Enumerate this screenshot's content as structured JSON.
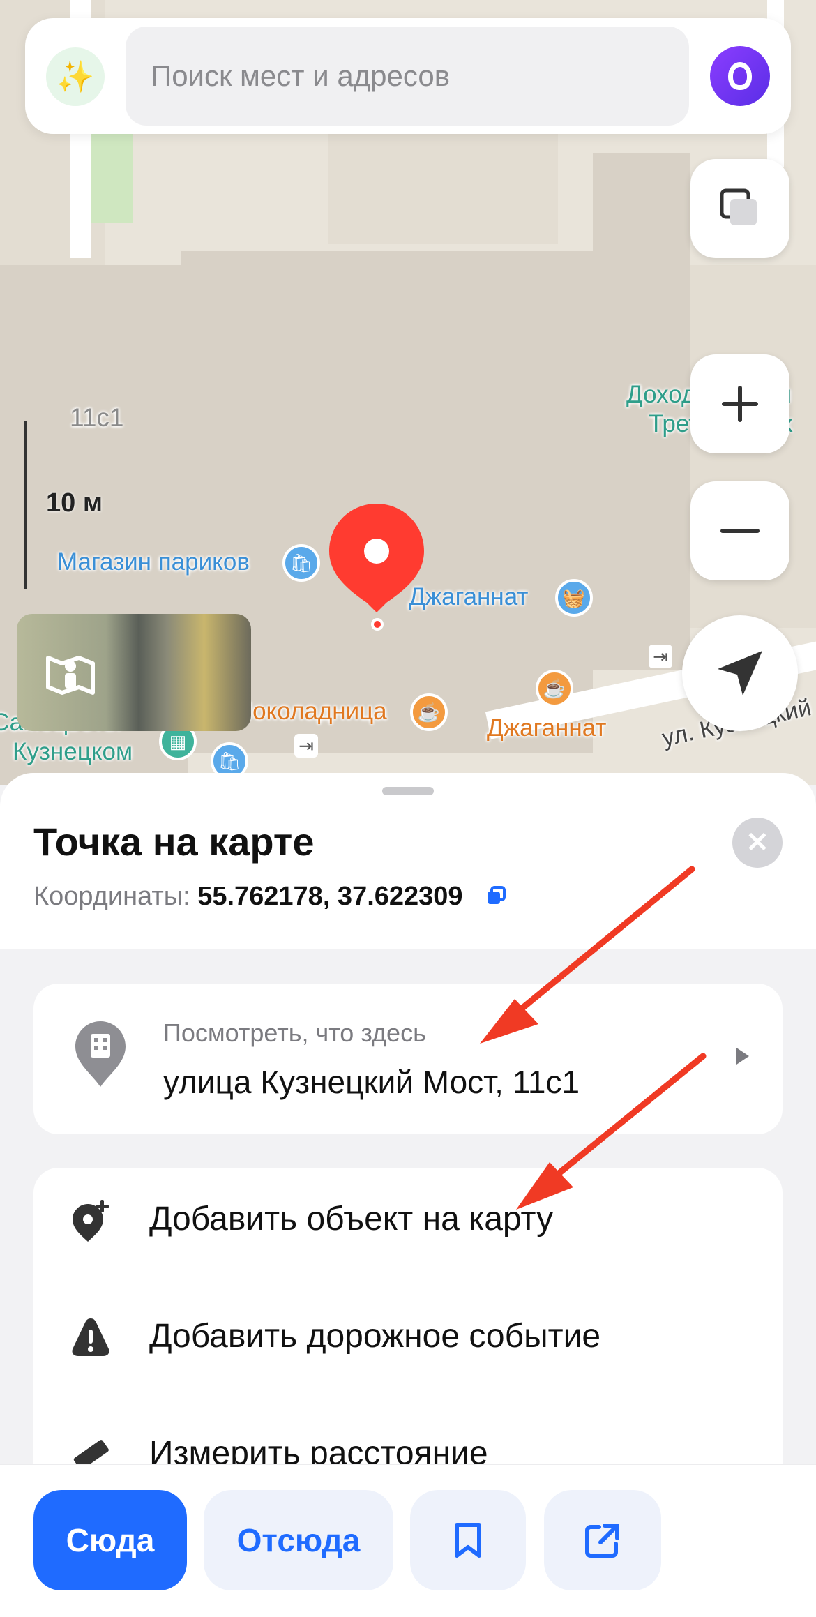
{
  "search": {
    "placeholder": "Поиск мест и адресов",
    "left_icon": "sparkles-icon",
    "right_icon": "alice-voice-assistant-icon"
  },
  "map": {
    "building_number": "11с1",
    "scale_label": "10 м",
    "labels": {
      "wig_shop": "Магазин париков",
      "jagannath_1": "Джаганнат",
      "jagannath_2": "Джаганнат",
      "shokoladnitsa": "Шоколадница",
      "kuznetskom_top": "Самоцветы",
      "kuznetskom": "Кузнецком",
      "dokhodny_1": "Доходный дом",
      "dokhodny_2": "Третьяковых",
      "street": "ул. Кузнецкий"
    },
    "controls": [
      "layers-icon",
      "zoom-in-icon",
      "zoom-out-icon",
      "locate-icon"
    ]
  },
  "sheet": {
    "title": "Точка на карте",
    "coords_label": "Координаты: ",
    "coords_value": "55.762178, 37.622309",
    "whats_here": {
      "label": "Посмотреть, что здесь",
      "address": "улица Кузнецкий Мост, 11с1"
    },
    "actions": [
      {
        "label": "Добавить объект на карту",
        "icon": "add-place-icon"
      },
      {
        "label": "Добавить дорожное событие",
        "icon": "warning-icon"
      },
      {
        "label": "Измерить расстояние",
        "icon": "ruler-icon"
      }
    ]
  },
  "bottom_bar": {
    "route_here": "Сюда",
    "route_from": "Отсюда",
    "bookmark_icon": "bookmark-icon",
    "share_icon": "share-icon"
  },
  "colors": {
    "accent": "#1f6bff",
    "pin": "#ff3b30",
    "annotation_arrow": "#f03a24"
  }
}
